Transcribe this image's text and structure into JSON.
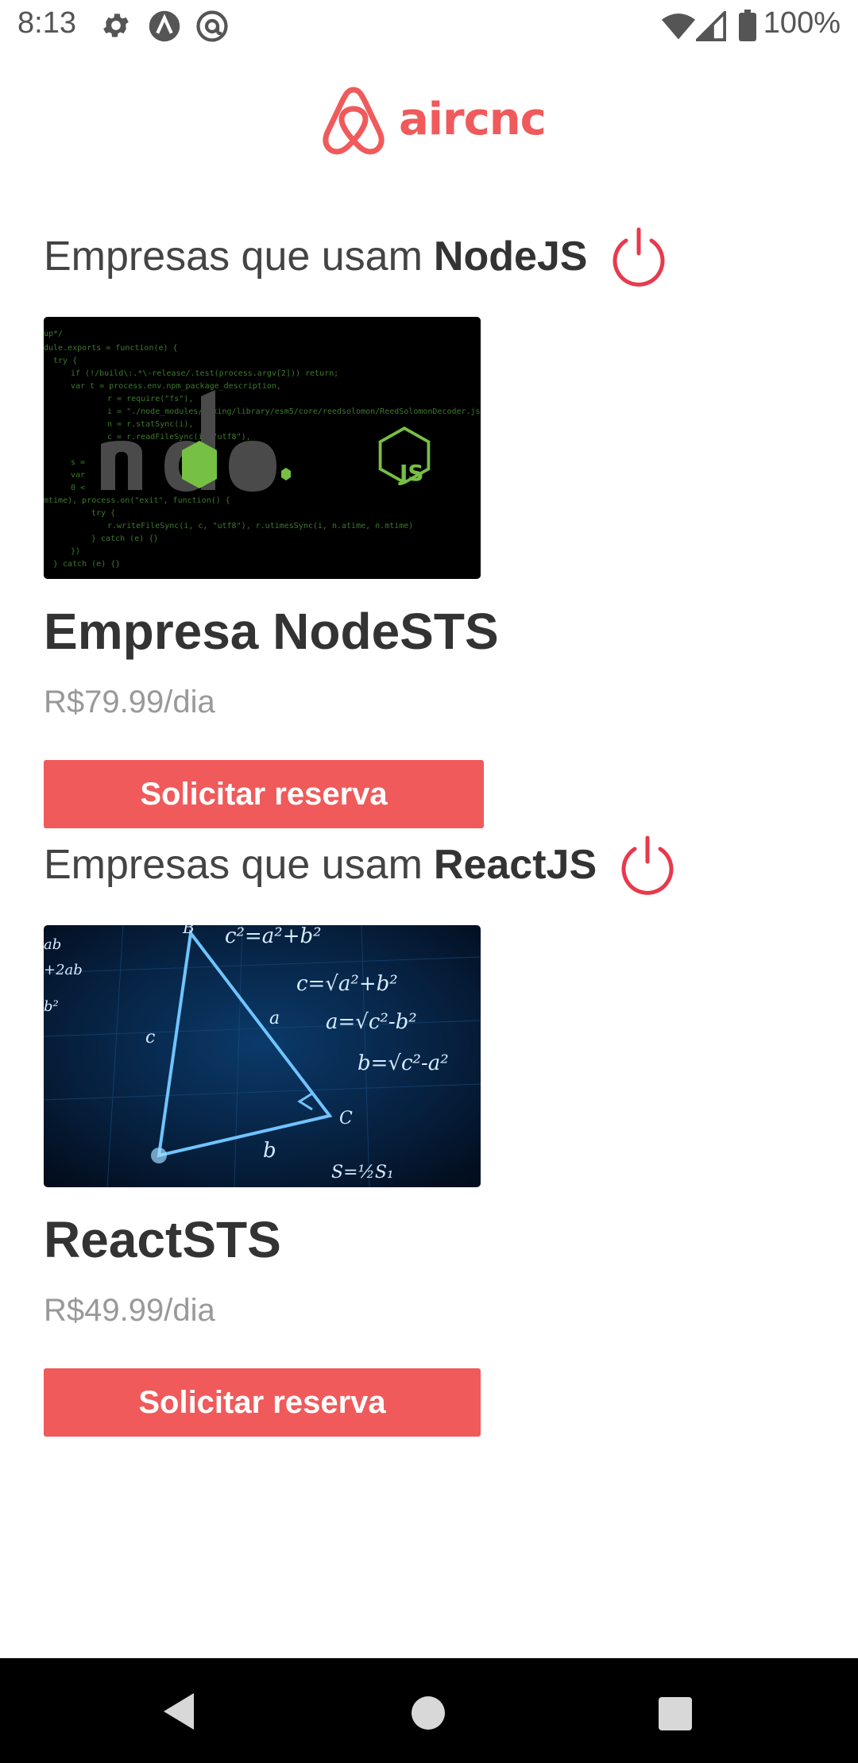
{
  "status_bar": {
    "time": "8:13",
    "icons": [
      "gear-icon",
      "a-badge-icon",
      "at-circle-icon"
    ],
    "right_icons": [
      "wifi-icon",
      "signal-icon",
      "battery-icon"
    ],
    "battery": "100%"
  },
  "app": {
    "logo_text": "aircnc",
    "brand_color": "#f05a5b"
  },
  "sections": [
    {
      "heading_prefix": "Empresas que usam",
      "heading_tech": "NodeJS",
      "icon": "power-icon",
      "spot": {
        "name": "Empresa NodeSTS",
        "price": "R$79.99/dia",
        "button": "Solicitar reserva",
        "image_icon": "nodejs-logo-icon"
      }
    },
    {
      "heading_prefix": "Empresas que usam",
      "heading_tech": "ReactJS",
      "icon": "power-icon",
      "spot": {
        "name": "ReactSTS",
        "price": "R$49.99/dia",
        "button": "Solicitar reserva",
        "image_icon": "math-triangle-image-icon"
      }
    }
  ],
  "nav_bar": {
    "icons": [
      "back-icon",
      "home-icon",
      "recents-icon"
    ]
  }
}
